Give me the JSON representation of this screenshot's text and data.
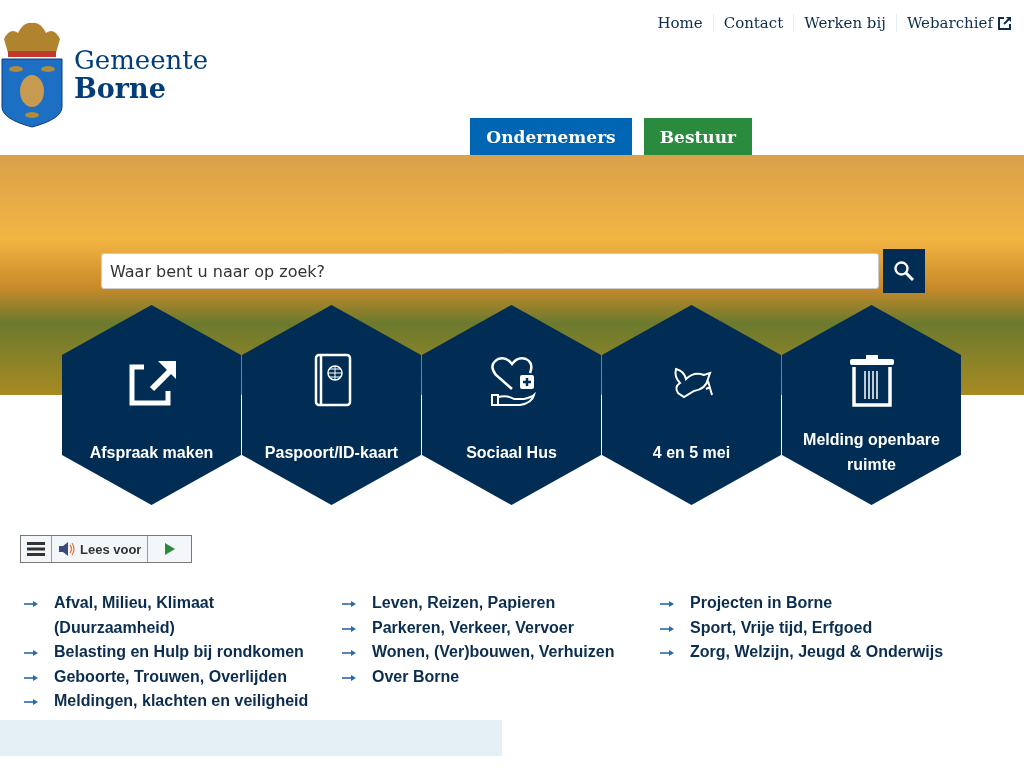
{
  "logo": {
    "line_1": "Gemeente",
    "line_2": "Borne"
  },
  "top_nav": [
    {
      "label": "Home",
      "external": false
    },
    {
      "label": "Contact",
      "external": false
    },
    {
      "label": "Werken bij",
      "external": false
    },
    {
      "label": "Webarchief",
      "external": true
    }
  ],
  "audience_tabs": [
    {
      "label": "Ondernemers",
      "color": "#0066b3"
    },
    {
      "label": "Bestuur",
      "color": "#2a8a3e"
    }
  ],
  "search": {
    "placeholder": "Waar bent u naar op zoek?"
  },
  "tiles": [
    {
      "label": "Afspraak maken",
      "kind": "external"
    },
    {
      "label": "Paspoort/ID-kaart",
      "kind": "passport"
    },
    {
      "label": "Sociaal Hus",
      "kind": "care"
    },
    {
      "label": "4 en 5 mei",
      "kind": "dove"
    },
    {
      "label": "Melding openbare ruimte",
      "kind": "bin"
    }
  ],
  "read_aloud": {
    "label": "Lees voor"
  },
  "topic_columns": [
    [
      "Afval, Milieu, Klimaat (Duurzaamheid)",
      "Belasting en Hulp bij rondkomen",
      "Geboorte, Trouwen, Overlijden",
      "Meldingen, klachten en veiligheid"
    ],
    [
      "Leven, Reizen, Papieren",
      "Parkeren, Verkeer, Vervoer",
      "Wonen, (Ver)bouwen, Verhuizen",
      "Over Borne"
    ],
    [
      "Projecten in Borne",
      "Sport, Vrije tijd, Erfgoed",
      "Zorg, Welzijn, Jeugd & Onderwijs"
    ]
  ]
}
